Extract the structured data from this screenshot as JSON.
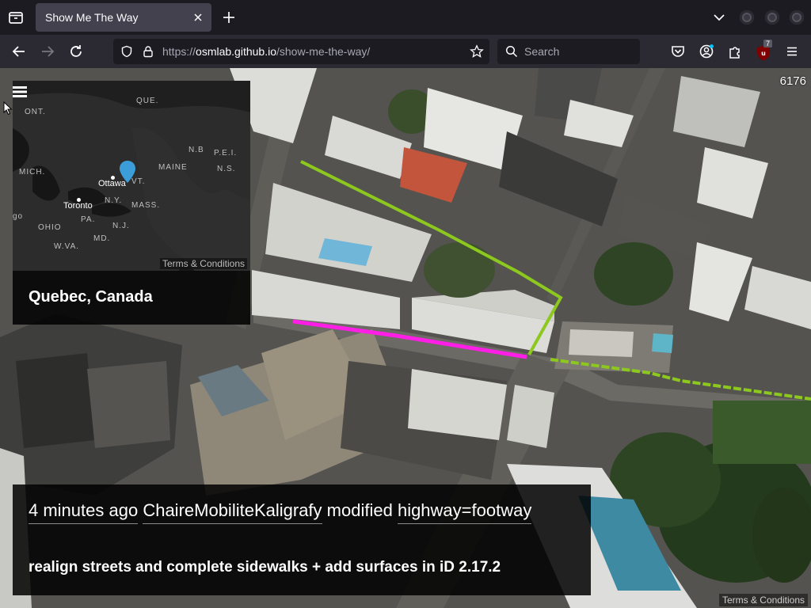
{
  "browser": {
    "tab_title": "Show Me The Way",
    "url_prefix": "https://",
    "url_domain": "osmlab.github.io",
    "url_path": "/show-me-the-way/",
    "search_placeholder": "Search",
    "extension_badge": "7"
  },
  "map": {
    "change_count": "6176",
    "terms_label": "Terms & Conditions"
  },
  "inset": {
    "place_name": "Quebec, Canada",
    "terms_label": "Terms & Conditions",
    "region_labels": [
      "ONT.",
      "QUE.",
      "N.B",
      "P.E.I.",
      "N.S.",
      "MAINE",
      "VT.",
      "MICH.",
      "N.Y.",
      "MASS.",
      "PA.",
      "OHIO",
      "MD.",
      "W.VA.",
      "go",
      "N.J."
    ],
    "cities": [
      "Ottawa",
      "Toronto"
    ]
  },
  "caption": {
    "time_ago": "4 minutes ago",
    "user": "ChaireMobiliteKaligrafy",
    "action": "modified",
    "tag": "highway=footway",
    "comment": "realign streets and complete sidewalks + add surfaces in iD 2.17.2"
  },
  "colors": {
    "modified_way": "#ff1ee6",
    "other_way": "#8cc81e",
    "panel_bg": "#000000"
  }
}
